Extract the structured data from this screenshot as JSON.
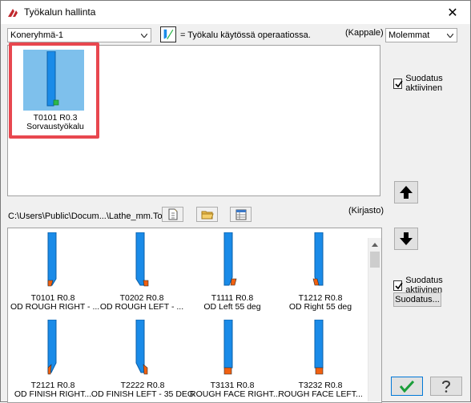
{
  "window": {
    "title": "Työkalun hallinta",
    "close_glyph": "✕"
  },
  "top": {
    "group_combo": "Koneryhmä-1",
    "legend_text": "= Työkalu käytössä operaatiossa.",
    "kappale_label": "(Kappale)",
    "filter_combo": "Molemmat"
  },
  "machine_tools": [
    {
      "id": "T0101 R0.3",
      "name": "Sorvaustyökalu"
    }
  ],
  "right": {
    "filter_active_1": "Suodatus aktiivinen",
    "filter_active_2": "Suodatus aktiivinen",
    "filter_button": "Suodatus..."
  },
  "library": {
    "path": "C:\\Users\\Public\\Docum...\\Lathe_mm.Tooldb",
    "kirjasto_label": "(Kirjasto)",
    "tools": [
      {
        "id": "T0101 R0.8",
        "name": "OD ROUGH RIGHT - ..."
      },
      {
        "id": "T0202 R0.8",
        "name": "OD ROUGH LEFT - ..."
      },
      {
        "id": "T1111 R0.8",
        "name": "OD Left 55 deg"
      },
      {
        "id": "T1212 R0.8",
        "name": "OD Right 55 deg"
      },
      {
        "id": "T2121 R0.8",
        "name": "OD FINISH RIGHT..."
      },
      {
        "id": "T2222 R0.8",
        "name": "OD FINISH LEFT - 35 DEG"
      },
      {
        "id": "T3131 R0.8",
        "name": "ROUGH FACE RIGHT..."
      },
      {
        "id": "T3232 R0.8",
        "name": "ROUGH FACE LEFT..."
      }
    ]
  },
  "colors": {
    "tool_blue": "#1a8be8",
    "insert_orange": "#f06010",
    "insert_green": "#2cb84a",
    "highlight_red": "#e8474f"
  }
}
